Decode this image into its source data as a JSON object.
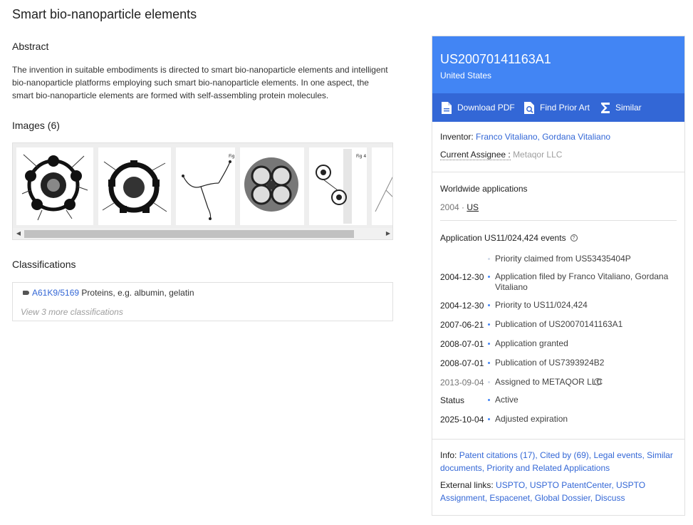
{
  "title": "Smart bio-nanoparticle elements",
  "abstract": {
    "heading": "Abstract",
    "text": "The invention in suitable embodiments is directed to smart bio-nanoparticle elements and intelligent bio-nanoparticle platforms employing such smart bio-nanoparticle elements. In one aspect, the smart bio-nanoparticle elements are formed with self-assembling protein molecules."
  },
  "images": {
    "heading": "Images (6)"
  },
  "classifications": {
    "heading": "Classifications",
    "code": "A61K9/5169",
    "description": "Proteins, e.g. albumin, gelatin",
    "more": "View 3 more classifications"
  },
  "side": {
    "pub_number": "US20070141163A1",
    "country": "United States",
    "actions": {
      "download": "Download PDF",
      "prior_art": "Find Prior Art",
      "similar": "Similar"
    },
    "inventor_label": "Inventor:",
    "inventors": "Franco Vitaliano, Gordana Vitaliano",
    "assignee_label": "Current Assignee :",
    "assignee": "Metaqor LLC",
    "worldwide_label": "Worldwide applications",
    "worldwide_year": "2004",
    "worldwide_sep": "·",
    "worldwide_country": "US",
    "events_heading": "Application US11/024,424 events",
    "events": [
      {
        "date": "",
        "text": "Priority claimed from US53435404P"
      },
      {
        "date": "2004-12-30",
        "text": "Application filed by Franco Vitaliano, Gordana Vitaliano"
      },
      {
        "date": "2004-12-30",
        "text": "Priority to US11/024,424"
      },
      {
        "date": "2007-06-21",
        "text": "Publication of US20070141163A1"
      },
      {
        "date": "2008-07-01",
        "text": "Application granted"
      },
      {
        "date": "2008-07-01",
        "text": "Publication of US7393924B2"
      },
      {
        "date": "2013-09-04",
        "text": "Assigned to METAQOR LLC"
      },
      {
        "date": "Status",
        "text": "Active"
      },
      {
        "date": "2025-10-04",
        "text": "Adjusted expiration"
      }
    ],
    "info_label": "Info:",
    "info_links": "Patent citations (17), Cited by (69), Legal events, Similar documents, Priority and Related Applications",
    "external_label": "External links:",
    "external_links": "USPTO, USPTO PatentCenter, USPTO Assignment, Espacenet, Global Dossier, Discuss"
  },
  "colors": {
    "header_blue": "#4285f4",
    "action_blue": "#3367d6",
    "link": "#3367d6"
  },
  "icons": [
    "pdf-icon",
    "search-doc-icon",
    "sigma-icon",
    "help-icon",
    "tag-icon",
    "chevron-left-icon",
    "chevron-right-icon"
  ]
}
